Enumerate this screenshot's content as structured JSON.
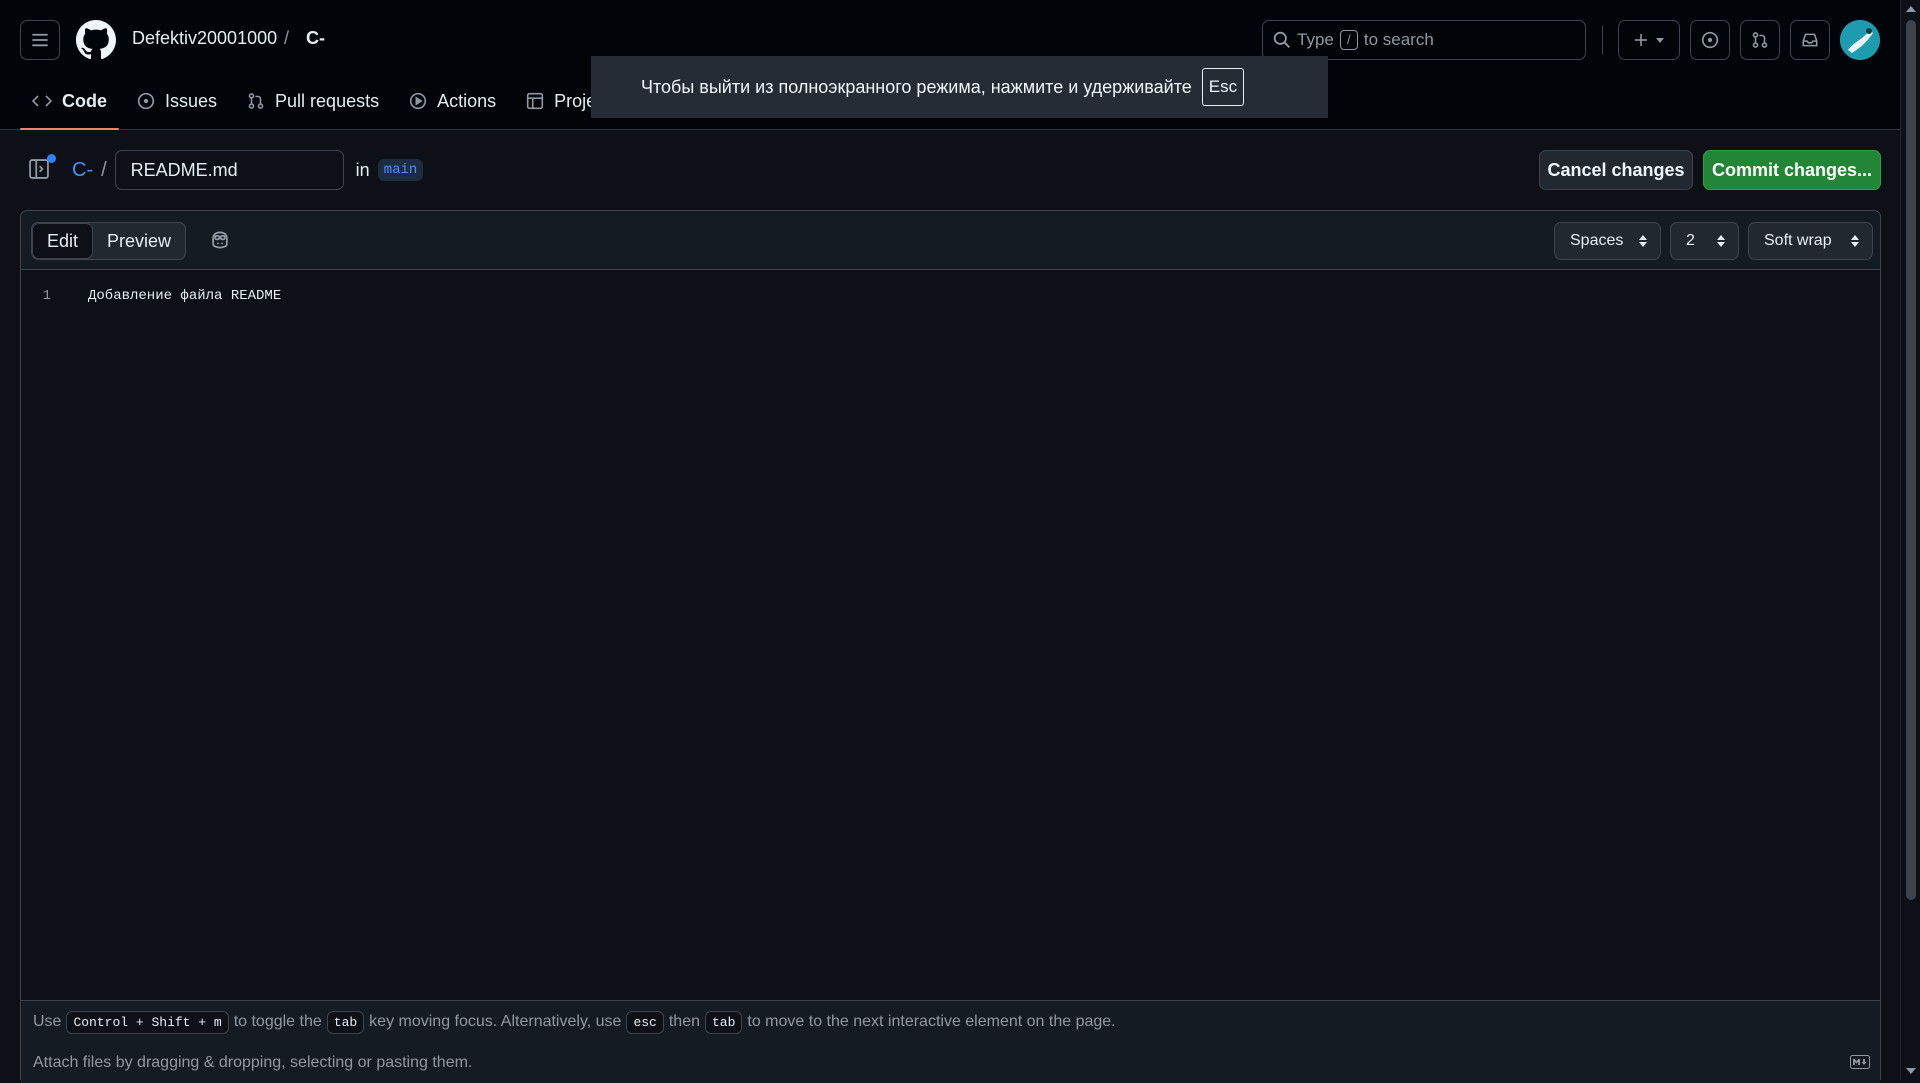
{
  "header": {
    "owner": "Defektiv20001000",
    "separator": "/",
    "repo": "C-",
    "search_type": "Type",
    "search_key": "/",
    "search_suffix": "to search"
  },
  "nav": {
    "code": "Code",
    "issues": "Issues",
    "pull_requests": "Pull requests",
    "actions": "Actions",
    "projects": "Proje"
  },
  "toast": {
    "message": "Чтобы выйти из полноэкранного режима, нажмите и удерживайте",
    "key": "Esc"
  },
  "filebar": {
    "repo": "C-",
    "separator": "/",
    "filename": "README.md",
    "in_label": "in",
    "branch": "main"
  },
  "actions": {
    "cancel": "Cancel changes",
    "commit": "Commit changes..."
  },
  "editor": {
    "tab_edit": "Edit",
    "tab_preview": "Preview",
    "indent_mode": "Spaces",
    "indent_size": "2",
    "wrap_mode": "Soft wrap",
    "lines": [
      {
        "number": "1",
        "text": "Добавление файла README"
      }
    ]
  },
  "hint": {
    "use": "Use",
    "shortcut": "Control + Shift + m",
    "toggle_text": "to toggle the",
    "tab_key": "tab",
    "moving_text": "key moving focus. Alternatively, use",
    "esc_key": "esc",
    "then_text": "then",
    "tab_key2": "tab",
    "end_text": "to move to the next interactive element on the page."
  },
  "attach": {
    "text": "Attach files by dragging & dropping, selecting or pasting them."
  },
  "colors": {
    "accent_green": "#238636",
    "link_blue": "#4493f8",
    "tab_underline": "#f78166",
    "background": "#0d1117"
  }
}
